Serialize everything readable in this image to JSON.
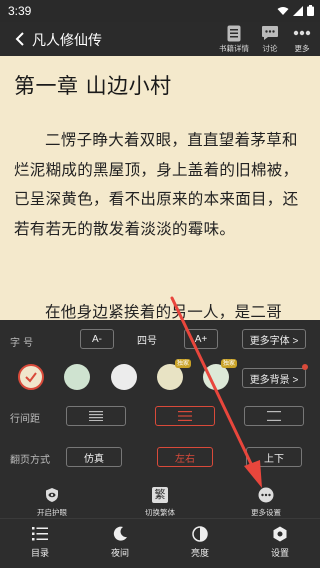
{
  "status_bar": {
    "time": "3:39"
  },
  "header": {
    "title": "凡人修仙传",
    "actions": [
      {
        "label": "书籍详情"
      },
      {
        "label": "讨论"
      },
      {
        "label": "更多"
      }
    ]
  },
  "reader": {
    "chapter_title": "第一章 山边小村",
    "paragraphs": [
      "二愣子睁大着双眼，直直望着茅草和烂泥糊成的黑屋顶，身上盖着的旧棉被，已呈深黄色，看不出原来的本来面目，还若有若无的散发着淡淡的霉味。",
      "在他身边紧挨着的另一人，是二哥"
    ]
  },
  "settings": {
    "font_size": {
      "label": "字    号",
      "decrease": "A-",
      "value": "四号",
      "increase": "A+",
      "more": "更多字体 >"
    },
    "background": {
      "swatches": [
        {
          "color": "#f0e6cc",
          "selected": true
        },
        {
          "color": "#cfe3d0",
          "selected": false
        },
        {
          "color": "#ececec",
          "selected": false
        },
        {
          "color": "#e8e3c4",
          "selected": false,
          "badge": "独家"
        },
        {
          "color": "#dde9d8",
          "selected": false,
          "badge": "独家"
        }
      ],
      "more": "更多背景 >",
      "selected_ring_color": "#d94a3a"
    },
    "line_spacing": {
      "label": "行间距",
      "options_active_index": 1
    },
    "page_mode": {
      "label": "翻页方式",
      "options": [
        "仿真",
        "左右",
        "上下"
      ],
      "active_index": 1
    },
    "tools": [
      {
        "label": "开启护眼",
        "icon": "eye-shield-icon"
      },
      {
        "label": "切换繁体",
        "icon": "traditional-icon",
        "glyph": "繁"
      },
      {
        "label": "更多设置",
        "icon": "more-dots-icon"
      }
    ]
  },
  "bottom_bar": {
    "tabs": [
      {
        "label": "目录",
        "icon": "list-icon"
      },
      {
        "label": "夜间",
        "icon": "moon-icon"
      },
      {
        "label": "亮度",
        "icon": "brightness-icon"
      },
      {
        "label": "设置",
        "icon": "gear-icon"
      }
    ]
  },
  "colors": {
    "accent": "#d94a3a",
    "panel_bg": "#2d2d2d",
    "paper": "#f4e9cc",
    "arrow": "#e8463c"
  }
}
